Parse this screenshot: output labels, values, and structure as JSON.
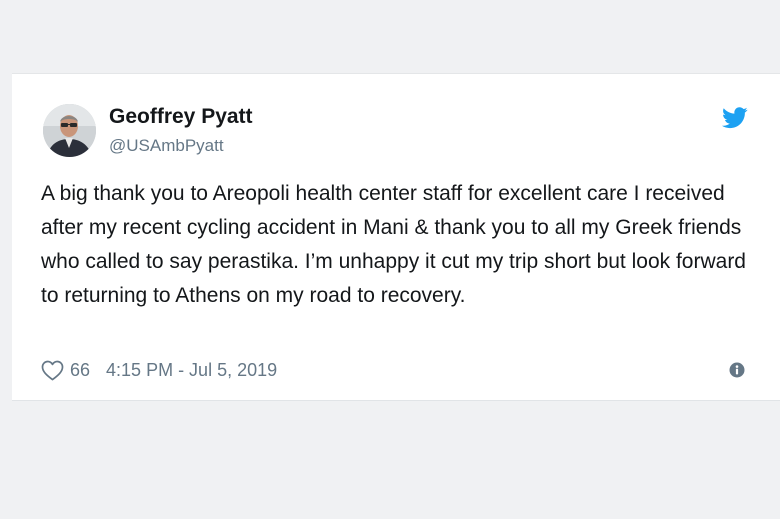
{
  "tweet": {
    "author_name": "Geoffrey Pyatt",
    "author_handle": "@USAmbPyatt",
    "text": "A big thank you to Areopoli health center staff for excellent care I received after my recent cycling accident in Mani & thank you to all my Greek friends who called to say perastika. I’m unhappy it cut my trip short but look forward to returning to Athens on my road to recovery.",
    "like_count": "66",
    "timestamp": "4:15 PM - Jul 5, 2019"
  },
  "icons": {
    "brand": "twitter-bird-icon",
    "like": "heart-icon",
    "info": "info-icon",
    "avatar": "profile-photo"
  },
  "colors": {
    "background": "#f0f1f3",
    "card": "#ffffff",
    "text": "#14171a",
    "secondary_text": "#657786",
    "twitter_blue": "#1da1f2"
  }
}
